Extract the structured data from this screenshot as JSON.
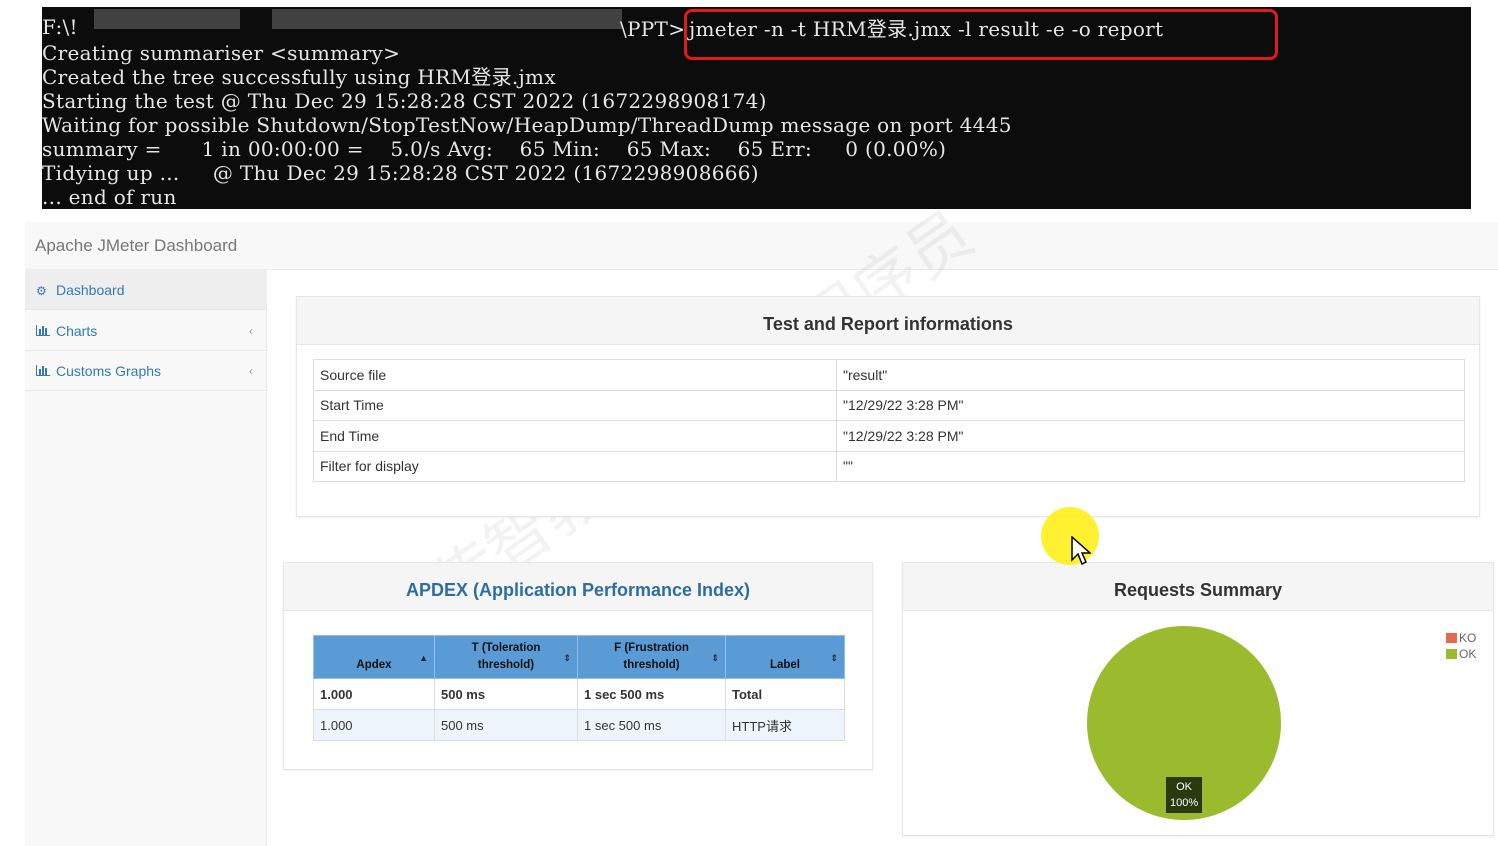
{
  "terminal": {
    "lines": [
      "F:\\!",
      "Creating summariser <summary>",
      "Created the tree successfully using HRM登录.jmx",
      "Starting the test @ Thu Dec 29 15:28:28 CST 2022 (1672298908174)",
      "Waiting for possible Shutdown/StopTestNow/HeapDump/ThreadDump message on port 4445",
      "summary =      1 in 00:00:00 =    5.0/s Avg:    65 Min:    65 Max:    65 Err:     0 (0.00%)",
      "Tidying up ...     @ Thu Dec 29 15:28:28 CST 2022 (1672298908666)",
      "... end of run"
    ],
    "path_tail": "\\PPT>",
    "command": "jmeter -n -t HRM登录.jmx -l result -e -o report",
    "highlight_color": "#e01b1b"
  },
  "app": {
    "brand": "Apache JMeter Dashboard"
  },
  "sidebar": {
    "items": [
      {
        "label": "Dashboard",
        "icon": "dashboard-icon"
      },
      {
        "label": "Charts",
        "icon": "bar-chart-icon"
      },
      {
        "label": "Customs Graphs",
        "icon": "bar-chart-icon"
      }
    ]
  },
  "info_panel": {
    "title": "Test and Report informations",
    "rows": [
      {
        "key": "Source file",
        "value": "\"result\""
      },
      {
        "key": "Start Time",
        "value": "\"12/29/22 3:28 PM\""
      },
      {
        "key": "End Time",
        "value": "\"12/29/22 3:28 PM\""
      },
      {
        "key": "Filter for display",
        "value": "\"\""
      }
    ]
  },
  "apdex_panel": {
    "title": "APDEX (Application Performance Index)",
    "headers": [
      "Apdex",
      "T (Toleration threshold)",
      "F (Frustration threshold)",
      "Label"
    ],
    "header_lines": [
      [
        "Apdex"
      ],
      [
        "T (Toleration",
        "threshold)"
      ],
      [
        "F (Frustration",
        "threshold)"
      ],
      [
        "Label"
      ]
    ],
    "rows": [
      {
        "apdex": "1.000",
        "t": "500 ms",
        "f": "1 sec 500 ms",
        "label": "Total"
      },
      {
        "apdex": "1.000",
        "t": "500 ms",
        "f": "1 sec 500 ms",
        "label": "HTTP请求"
      }
    ],
    "header_color": "#5b9bd5"
  },
  "requests_panel": {
    "title": "Requests Summary",
    "legend": [
      {
        "label": "KO",
        "color": "#e36a4f"
      },
      {
        "label": "OK",
        "color": "#9bbb2f"
      }
    ]
  },
  "chart_data": {
    "type": "pie",
    "title": "Requests Summary",
    "labels": [
      "KO",
      "OK"
    ],
    "values": [
      0,
      100
    ],
    "colors": [
      "#e36a4f",
      "#9bbb2f"
    ],
    "slice_label": {
      "name": "OK",
      "value": "100%"
    },
    "legend_position": "top-right"
  },
  "watermark": "传智教育—黑马程序员"
}
